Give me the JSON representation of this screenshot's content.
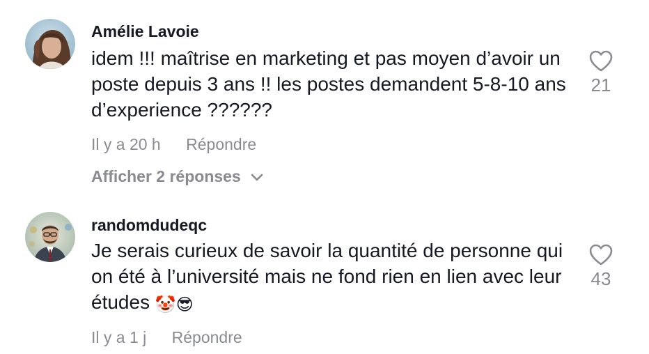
{
  "comments": [
    {
      "username": "Amélie Lavoie",
      "text": "idem !!! maîtrise en marketing et pas moyen d’avoir un poste depuis 3 ans !! les postes demandent 5-8-10 ans d’experience ??????",
      "time": "Il y a 20 h",
      "reply_label": "Répondre",
      "likes": "21",
      "show_replies": "Afficher 2 réponses"
    },
    {
      "username": "randomdudeqc",
      "text": "Je serais curieux de savoir la quantité de personne qui on été à l’université mais ne fond rien en lien avec leur études",
      "emojis": "🤡😎",
      "time": "Il y a 1 j",
      "reply_label": "Répondre",
      "likes": "43"
    }
  ]
}
